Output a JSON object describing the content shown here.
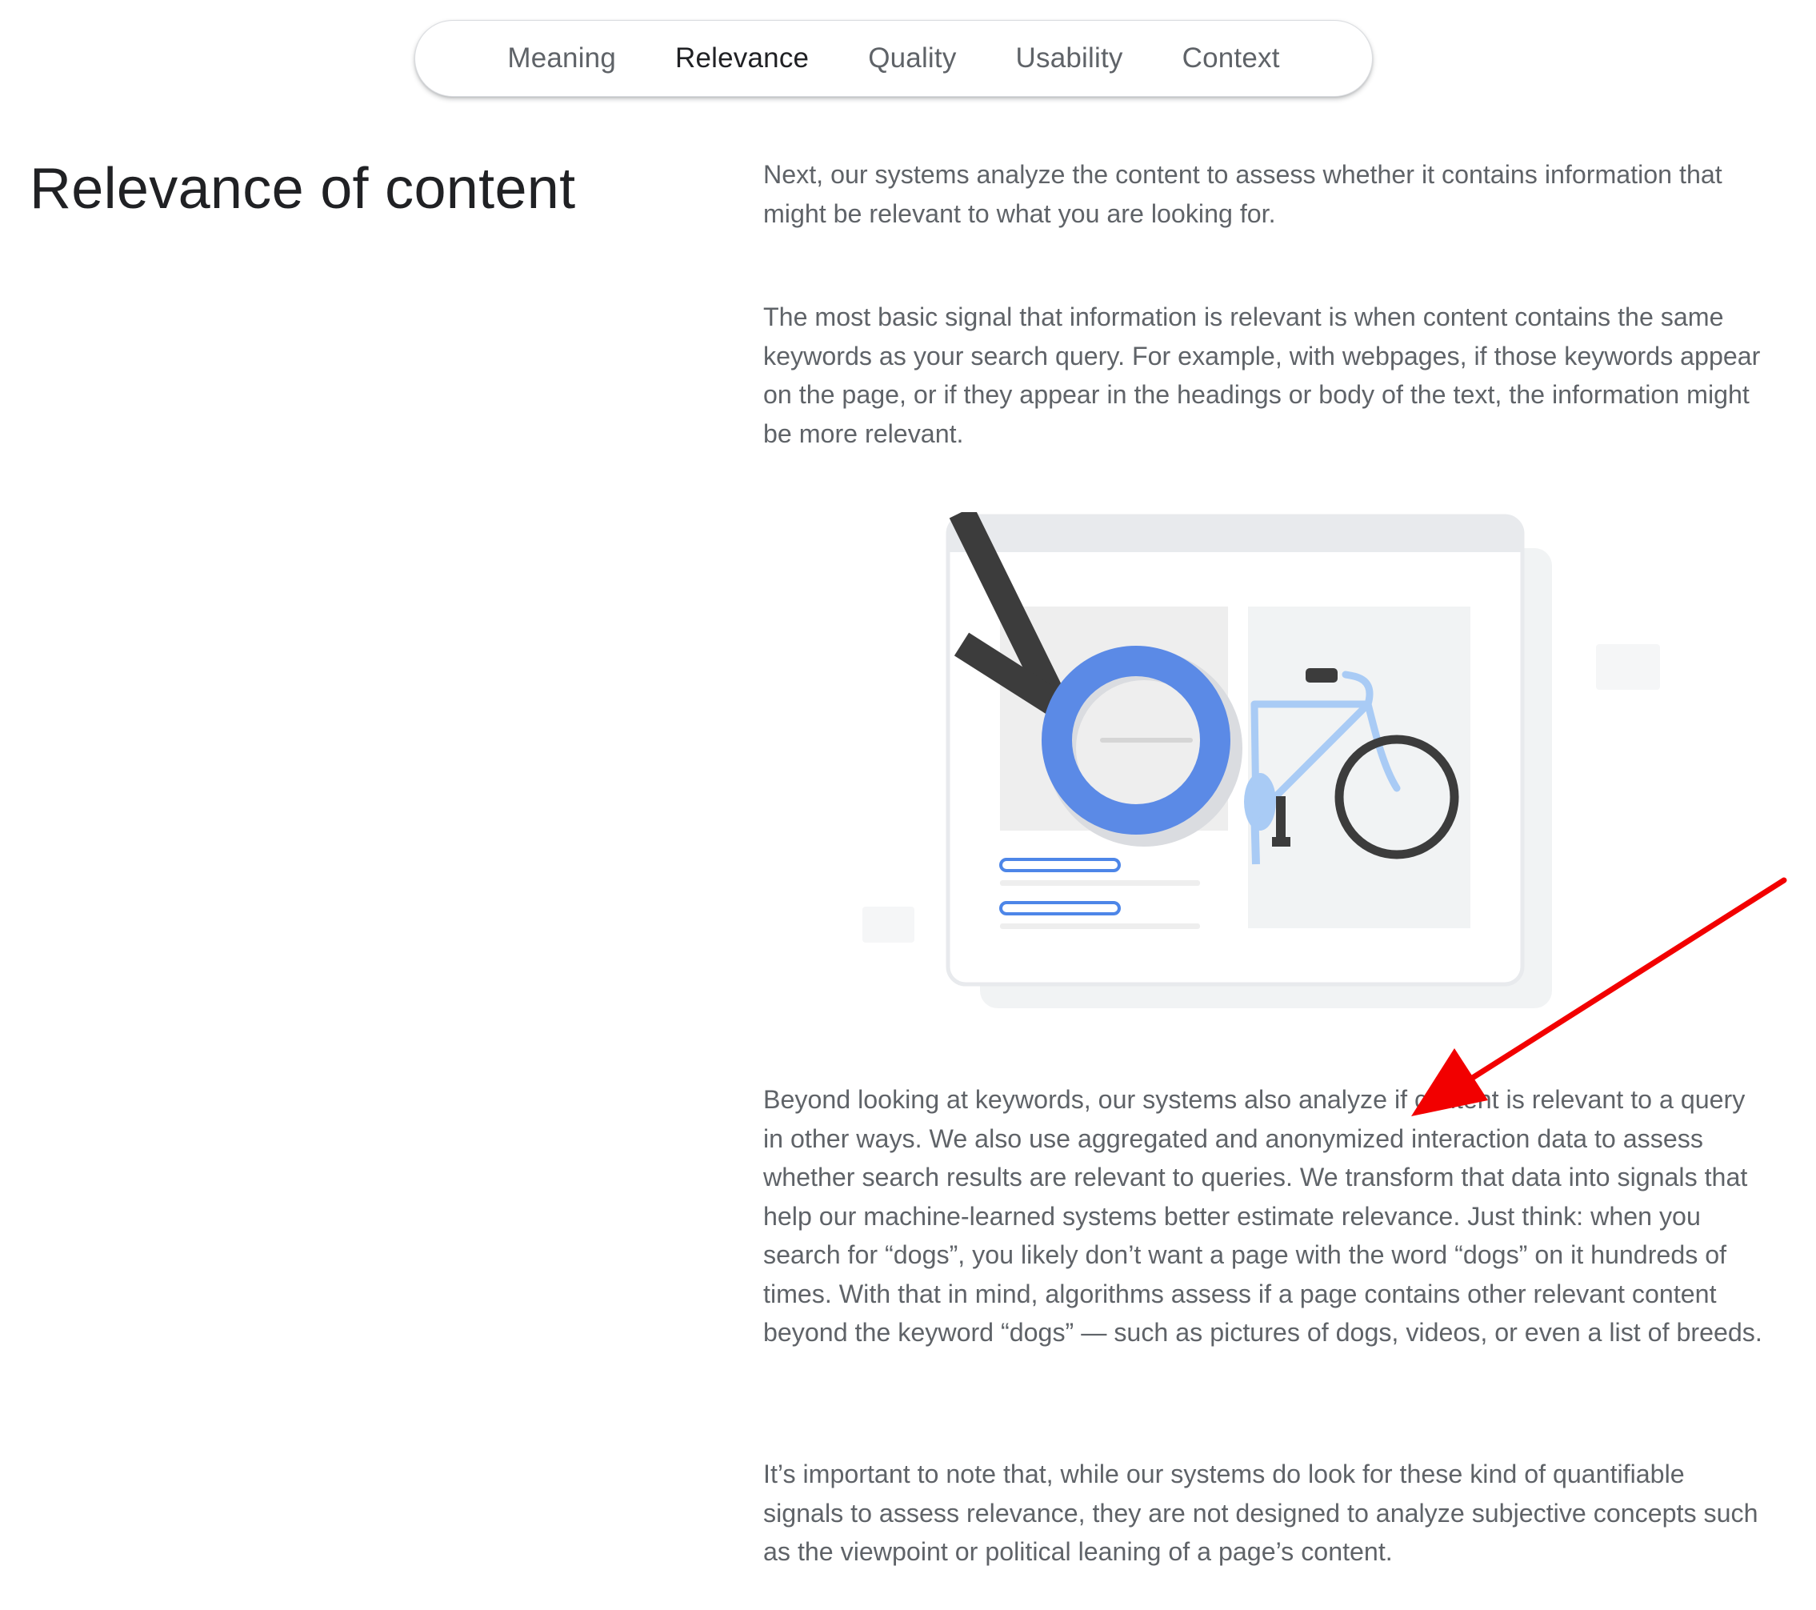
{
  "nav": {
    "tabs": [
      {
        "label": "Meaning",
        "active": false
      },
      {
        "label": "Relevance",
        "active": true
      },
      {
        "label": "Quality",
        "active": false
      },
      {
        "label": "Usability",
        "active": false
      },
      {
        "label": "Context",
        "active": false
      }
    ]
  },
  "section": {
    "title": "Relevance of content",
    "paragraphs": [
      "Next, our systems analyze the content to assess whether it contains information that might be relevant to what you are looking for.",
      "The most basic signal that information is relevant is when content contains the same keywords as your search query. For example, with webpages, if those keywords appear on the page, or if they appear in the headings or body of the text, the information might be more relevant.",
      "Beyond looking at keywords, our systems also analyze if content is relevant to a query in other ways. We also use aggregated and anonymized interaction data to assess whether search results are relevant to queries. We transform that data into signals that help our machine-learned systems better estimate relevance. Just think: when you search for “dogs”, you likely don’t want a page with the word “dogs” on it hundreds of times. With that in mind, algorithms assess if a page contains other relevant content beyond the keyword “dogs” — such as pictures of dogs, videos, or even a list of breeds.",
      "It’s important to note that, while our systems do look for these kind of quantifiable signals to assess relevance, they are not designed to analyze subjective concepts such as the viewpoint or political leaning of a page’s content."
    ]
  },
  "colors": {
    "accent_blue": "#5b8ae6",
    "light_blue": "#a9cbf5",
    "dark_gray": "#3c3c3c",
    "annotation_red": "#f20000"
  },
  "icons": {
    "illustration": "magnifier-over-bicycle-illustration",
    "annotation": "red-arrow-annotation"
  }
}
